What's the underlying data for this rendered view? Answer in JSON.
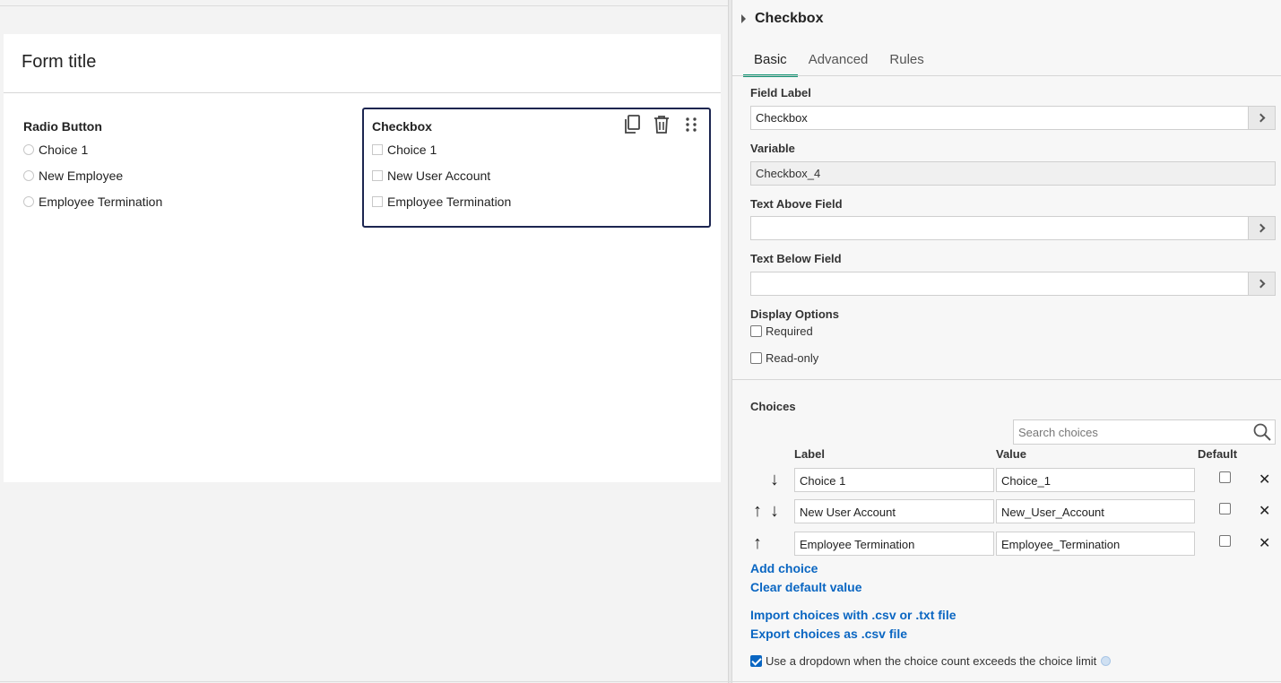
{
  "form": {
    "title": "Form title",
    "radio_field": {
      "title": "Radio Button",
      "options": [
        "Choice 1",
        "New Employee",
        "Employee Termination"
      ]
    },
    "checkbox_field": {
      "title": "Checkbox",
      "options": [
        "Choice 1",
        "New User Account",
        "Employee Termination"
      ]
    }
  },
  "panel": {
    "title": "Checkbox",
    "tabs": [
      {
        "label": "Basic",
        "active": true
      },
      {
        "label": "Advanced",
        "active": false
      },
      {
        "label": "Rules",
        "active": false
      }
    ],
    "field_label": {
      "label": "Field Label",
      "value": "Checkbox"
    },
    "variable": {
      "label": "Variable",
      "value": "Checkbox_4"
    },
    "text_above": {
      "label": "Text Above Field",
      "value": ""
    },
    "text_below": {
      "label": "Text Below Field",
      "value": ""
    },
    "display_options": {
      "label": "Display Options",
      "required": {
        "label": "Required",
        "checked": false
      },
      "readonly": {
        "label": "Read-only",
        "checked": false
      }
    },
    "choices": {
      "label": "Choices",
      "search_placeholder": "Search choices",
      "columns": {
        "label": "Label",
        "value": "Value",
        "default": "Default"
      },
      "rows": [
        {
          "label": "Choice 1",
          "value": "Choice_1",
          "move_up": false,
          "move_down": true,
          "default": false
        },
        {
          "label": "New User Account",
          "value": "New_User_Account",
          "move_up": true,
          "move_down": true,
          "default": false
        },
        {
          "label": "Employee Termination",
          "value": "Employee_Termination",
          "move_up": true,
          "move_down": false,
          "default": false
        }
      ],
      "add_choice": "Add choice",
      "clear_default": "Clear default value",
      "import": "Import choices with .csv or .txt file",
      "export": "Export choices as .csv file",
      "dropdown_option": {
        "label": "Use a dropdown when the choice count exceeds the choice limit",
        "checked": true
      }
    }
  },
  "colors": {
    "accent": "#0a8f6e",
    "link": "#0a66c2",
    "selected_border": "#1c2550"
  }
}
